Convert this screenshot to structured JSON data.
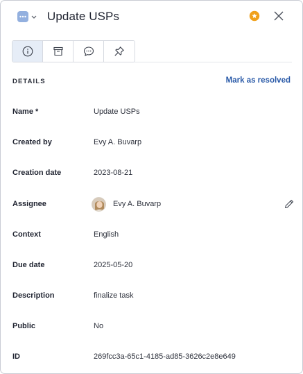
{
  "header": {
    "title": "Update USPs",
    "type_icon": "ellipsis-chat-icon",
    "accent_color": "#f0a11c",
    "badge_color": "#93b0df"
  },
  "tabs": [
    {
      "name": "tab-info",
      "icon": "info-icon",
      "active": true
    },
    {
      "name": "tab-archive",
      "icon": "archive-box-icon",
      "active": false
    },
    {
      "name": "tab-comments",
      "icon": "chat-bubble-icon",
      "active": false
    },
    {
      "name": "tab-pin",
      "icon": "pin-icon",
      "active": false
    }
  ],
  "details": {
    "section_title": "DETAILS",
    "resolve_label": "Mark as resolved",
    "name_label": "Name *",
    "name_value": "Update USPs",
    "created_by_label": "Created by",
    "created_by_value": "Evy A. Buvarp",
    "creation_date_label": "Creation date",
    "creation_date_value": "2023-08-21",
    "assignee_label": "Assignee",
    "assignee_value": "Evy A. Buvarp",
    "context_label": "Context",
    "context_value": "English",
    "due_date_label": "Due date",
    "due_date_value": "2025-05-20",
    "description_label": "Description",
    "description_value": "finalize task",
    "public_label": "Public",
    "public_value": "No",
    "id_label": "ID",
    "id_value": "269fcc3a-65c1-4185-ad85-3626c2e8e649"
  }
}
